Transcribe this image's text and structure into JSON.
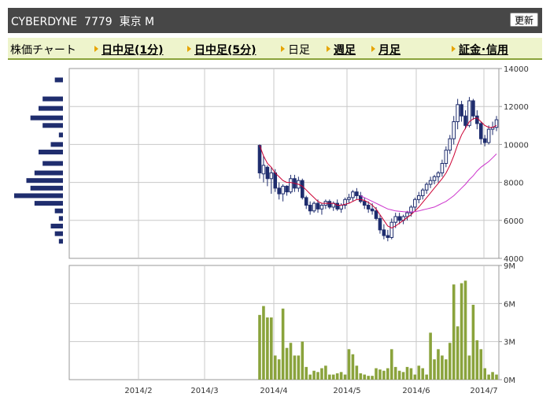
{
  "header": {
    "title": "CYBERDYNE  7779  東京 M",
    "refresh_label": "更新"
  },
  "tabs": [
    {
      "label": "株価チャート",
      "link": false,
      "arrow": false
    },
    {
      "label": "日中足(1分)",
      "link": true,
      "arrow": true
    },
    {
      "label": "日中足(5分)",
      "link": true,
      "arrow": true
    },
    {
      "label": "日足",
      "link": false,
      "arrow": true
    },
    {
      "label": "週足",
      "link": true,
      "arrow": true
    },
    {
      "label": "月足",
      "link": true,
      "arrow": true
    },
    {
      "label": "証金･信用",
      "link": true,
      "arrow": true
    }
  ],
  "colors": {
    "candle": "#1f2d6e",
    "ma_short": "#cc0033",
    "ma_long": "#cc33cc",
    "volume": "#8aa33c",
    "profile": "#1f2d6e",
    "grid": "#c8c8c8"
  },
  "chart_data": [
    {
      "type": "candlestick",
      "title": "",
      "y_ticks": [
        4000,
        6000,
        8000,
        10000,
        12000,
        14000
      ],
      "ylim": [
        4000,
        14000
      ],
      "x_ticks": [
        "2014/2",
        "2014/3",
        "2014/4",
        "2014/5",
        "2014/6",
        "2014/7"
      ],
      "grid": true,
      "series": [
        {
          "name": "",
          "values": [
            [
              9950,
              10000,
              8200,
              8500
            ],
            [
              8450,
              9400,
              8000,
              8900
            ],
            [
              8800,
              8900,
              7800,
              8200
            ],
            [
              8200,
              8800,
              7400,
              8500
            ],
            [
              8500,
              8700,
              7500,
              7700
            ],
            [
              7700,
              8000,
              7100,
              7400
            ],
            [
              7400,
              7900,
              7000,
              7800
            ],
            [
              7800,
              7850,
              7300,
              7500
            ],
            [
              7500,
              8400,
              7400,
              8200
            ],
            [
              8200,
              8400,
              7500,
              7700
            ],
            [
              7700,
              8300,
              7500,
              8100
            ],
            [
              8100,
              8200,
              7100,
              7200
            ],
            [
              7200,
              7300,
              6600,
              6800
            ],
            [
              6800,
              7000,
              6300,
              6500
            ],
            [
              6500,
              7000,
              6400,
              6900
            ],
            [
              6900,
              7100,
              6400,
              6600
            ],
            [
              6600,
              6900,
              6300,
              6800
            ],
            [
              6800,
              7100,
              6600,
              7000
            ],
            [
              7000,
              7100,
              6600,
              6700
            ],
            [
              6700,
              7000,
              6500,
              6900
            ],
            [
              6900,
              7100,
              6500,
              6600
            ],
            [
              6600,
              6900,
              6400,
              6800
            ],
            [
              6800,
              7200,
              6600,
              7100
            ],
            [
              7100,
              7400,
              6900,
              7200
            ],
            [
              7200,
              7600,
              7000,
              7500
            ],
            [
              7500,
              7700,
              7100,
              7300
            ],
            [
              7300,
              7500,
              6900,
              7000
            ],
            [
              7000,
              7200,
              6600,
              6800
            ],
            [
              6800,
              7000,
              6400,
              6600
            ],
            [
              6600,
              6900,
              6300,
              6500
            ],
            [
              6500,
              6700,
              6000,
              6100
            ],
            [
              6100,
              6300,
              5300,
              5500
            ],
            [
              5500,
              5800,
              5000,
              5200
            ],
            [
              5200,
              5500,
              4900,
              5100
            ],
            [
              5100,
              6100,
              5000,
              5900
            ],
            [
              5900,
              6400,
              5600,
              6200
            ],
            [
              6200,
              6400,
              5800,
              6000
            ],
            [
              6000,
              6300,
              5800,
              6200
            ],
            [
              6200,
              6500,
              6000,
              6400
            ],
            [
              6400,
              6800,
              6200,
              6700
            ],
            [
              6700,
              7200,
              6500,
              7100
            ],
            [
              7100,
              7500,
              6900,
              7300
            ],
            [
              7300,
              7700,
              7100,
              7600
            ],
            [
              7600,
              8000,
              7400,
              7900
            ],
            [
              7900,
              8300,
              7700,
              8100
            ],
            [
              8100,
              8400,
              7900,
              8300
            ],
            [
              8300,
              8600,
              8000,
              8500
            ],
            [
              8500,
              9200,
              8300,
              9000
            ],
            [
              9000,
              9900,
              8800,
              9700
            ],
            [
              9700,
              10500,
              9500,
              10300
            ],
            [
              10300,
              11500,
              10000,
              11200
            ],
            [
              11200,
              12400,
              10800,
              12100
            ],
            [
              12100,
              12300,
              11200,
              11500
            ],
            [
              11500,
              11800,
              10800,
              11000
            ],
            [
              11000,
              12500,
              10900,
              12300
            ],
            [
              12300,
              12400,
              11300,
              11500
            ],
            [
              11500,
              11800,
              10800,
              11100
            ],
            [
              11100,
              11200,
              10000,
              10300
            ],
            [
              10300,
              10500,
              9900,
              10100
            ],
            [
              10100,
              11000,
              10000,
              10800
            ],
            [
              10800,
              11200,
              10500,
              10900
            ],
            [
              10900,
              11500,
              10700,
              11300
            ]
          ]
        },
        {
          "name": "",
          "values": [
            9950,
            9400,
            9000,
            8800,
            8500,
            8300,
            8100,
            8000,
            8000,
            7950,
            7900,
            7800,
            7600,
            7400,
            7200,
            7000,
            6900,
            6900,
            6900,
            6900,
            6800,
            6800,
            6850,
            6900,
            7000,
            7100,
            7100,
            7050,
            6950,
            6800,
            6600,
            6300,
            6000,
            5700,
            5600,
            5700,
            5850,
            6000,
            6150,
            6300,
            6500,
            6700,
            6950,
            7200,
            7450,
            7700,
            7950,
            8200,
            8500,
            8900,
            9400,
            10000,
            10500,
            10850,
            11200,
            11350,
            11400,
            11200,
            11000,
            10900,
            10900,
            11000
          ]
        },
        {
          "name": "",
          "values": [
            null,
            null,
            null,
            null,
            null,
            null,
            null,
            null,
            null,
            null,
            null,
            null,
            null,
            null,
            null,
            null,
            null,
            null,
            null,
            null,
            null,
            null,
            null,
            null,
            null,
            null,
            7300,
            7200,
            7100,
            7000,
            6900,
            6800,
            6700,
            6600,
            6550,
            6500,
            6480,
            6460,
            6450,
            6450,
            6460,
            6500,
            6550,
            6600,
            6650,
            6700,
            6800,
            6900,
            7000,
            7150,
            7300,
            7500,
            7700,
            7900,
            8150,
            8350,
            8600,
            8800,
            8950,
            9100,
            9300,
            9500
          ]
        }
      ]
    },
    {
      "type": "bar",
      "title": "",
      "y_ticks": [
        "0M",
        "3M",
        "6M",
        "9M"
      ],
      "ylim": [
        0,
        9
      ],
      "values": [
        5.1,
        5.8,
        4.9,
        4.9,
        1.9,
        1.6,
        5.6,
        2.5,
        2.9,
        1.9,
        1.9,
        3.0,
        1.0,
        0.4,
        0.7,
        0.6,
        0.9,
        1.1,
        0.4,
        0.4,
        0.5,
        0.6,
        0.4,
        2.4,
        2.0,
        1.1,
        0.5,
        0.4,
        0.3,
        0.3,
        0.9,
        0.8,
        0.7,
        0.9,
        2.4,
        1.0,
        0.7,
        0.6,
        1.0,
        0.9,
        0.4,
        1.1,
        0.9,
        0.4,
        3.7,
        1.6,
        2.4,
        1.9,
        1.6,
        2.9,
        7.5,
        4.2,
        7.6,
        7.8,
        1.9,
        5.9,
        3.1,
        2.4,
        0.9,
        0.4,
        0.6,
        0.4
      ]
    },
    {
      "type": "bar",
      "title": "",
      "orientation": "horizontal",
      "price_levels": [
        13400,
        12800,
        12400,
        11900,
        11400,
        11000,
        10500,
        10000,
        9600,
        9000,
        8500,
        8100,
        7700,
        7300,
        6900,
        6500,
        6100,
        5700,
        5300,
        4900
      ],
      "values": [
        2,
        0,
        5,
        6,
        8,
        5,
        1,
        3,
        6,
        5,
        7,
        9,
        8,
        12,
        7,
        2,
        1,
        3,
        2,
        1
      ]
    }
  ]
}
